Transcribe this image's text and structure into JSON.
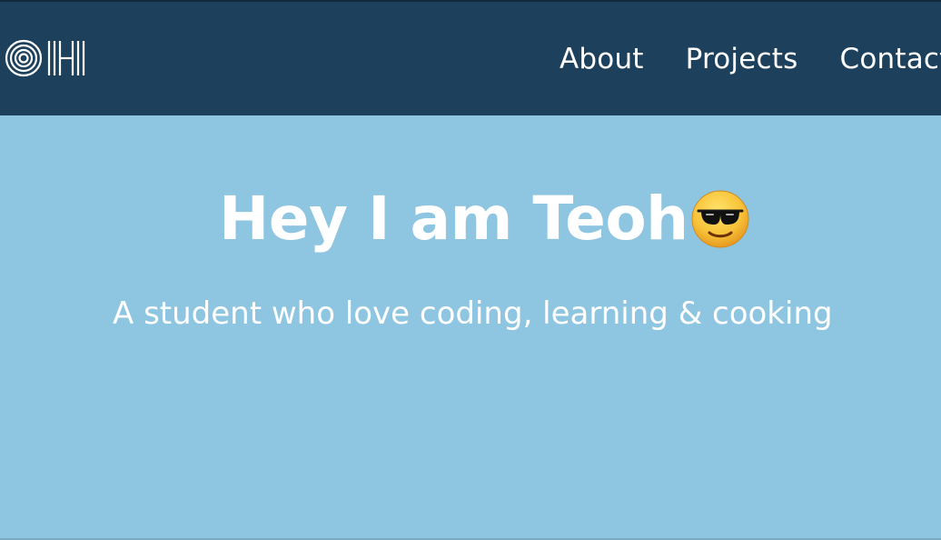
{
  "header": {
    "logo_text": "TEOH",
    "nav": [
      {
        "label": "About"
      },
      {
        "label": "Projects"
      },
      {
        "label": "Contact"
      }
    ]
  },
  "hero": {
    "title": "Hey I am Teoh",
    "title_emoji": "smiling-face-with-sunglasses-icon",
    "subtitle": "A student who love coding, learning & cooking"
  },
  "colors": {
    "header_bg": "#1d415c",
    "hero_bg": "#8ec5e1",
    "text": "#ffffff"
  }
}
